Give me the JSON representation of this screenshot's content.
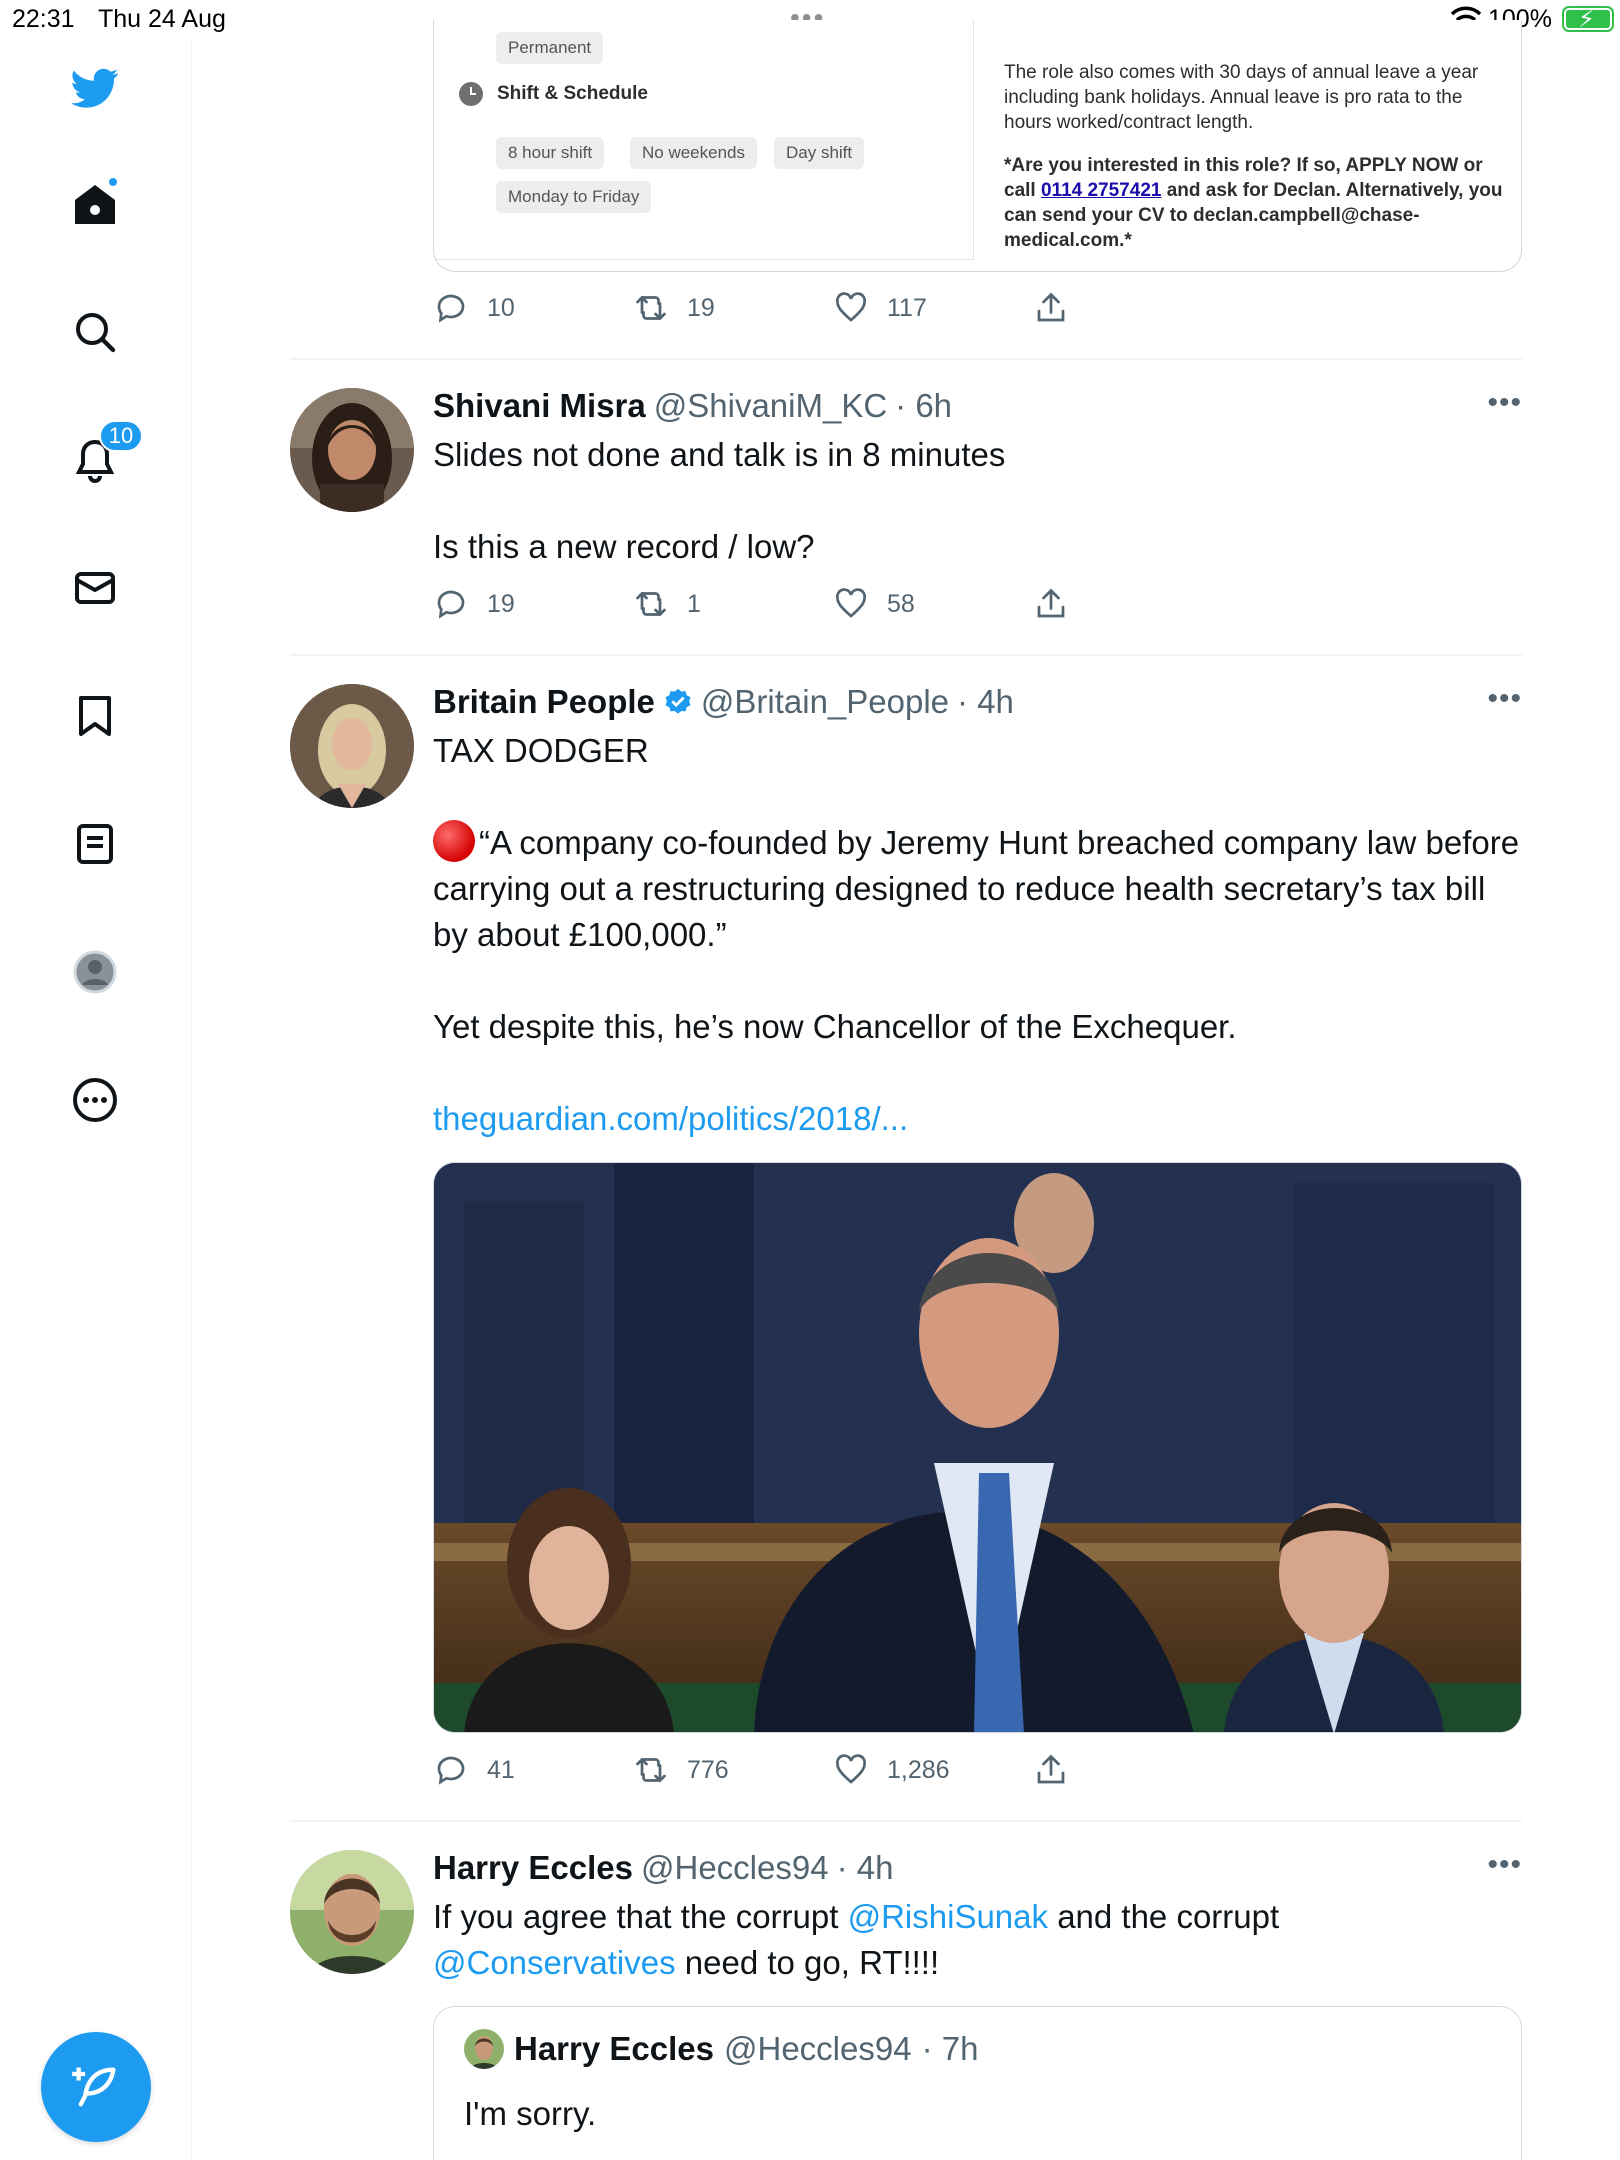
{
  "status_bar": {
    "time": "22:31",
    "date": "Thu 24 Aug",
    "battery": "100%"
  },
  "sidebar": {
    "notifications_badge": "10",
    "items": [
      {
        "icon": "twitter-bird-logo"
      },
      {
        "icon": "home-icon"
      },
      {
        "icon": "search-icon"
      },
      {
        "icon": "bell-icon"
      },
      {
        "icon": "mail-icon"
      },
      {
        "icon": "bookmark-icon"
      },
      {
        "icon": "lists-icon"
      },
      {
        "icon": "profile-icon"
      },
      {
        "icon": "more-icon"
      }
    ],
    "accent_color": "#1d9bf0"
  },
  "job_card": {
    "chip_permanent": "Permanent",
    "section_title": "Shift & Schedule",
    "chips": [
      "8 hour shift",
      "No weekends",
      "Day shift",
      "Monday to Friday"
    ],
    "text_leave": "The role also comes with 30 days of annual leave a year including bank holidays. Annual leave is pro rata to the hours worked/contract length.",
    "text_apply_1": "*Are you interested in this role? If so, APPLY NOW or call",
    "phone": "0114 2757421",
    "text_apply_2": "and ask for Declan. Alternatively, you can send your CV to declan.campbell@chase-medical.com.*"
  },
  "tweet0_actions": {
    "replies": "10",
    "retweets": "19",
    "likes": "117"
  },
  "tweets": [
    {
      "name": "Shivani Misra",
      "handle": "@ShivaniM_KC",
      "time": "· 6h",
      "text_1": "Slides not done and talk is in 8 minutes",
      "text_2": "Is this a new record / low?",
      "replies": "19",
      "retweets": "1",
      "likes": "58"
    },
    {
      "name": "Britain People",
      "handle": "@Britain_People",
      "time": "· 4h",
      "text_1": "TAX DODGER",
      "text_2": "“A company co-founded by Jeremy Hunt breached company law before carrying out a restructuring designed to reduce health secretary’s tax bill by about £100,000.”",
      "text_3": "Yet despite this, he’s now Chancellor of the Exchequer.",
      "link": "theguardian.com/politics/2018/...",
      "replies": "41",
      "retweets": "776",
      "likes": "1,286"
    },
    {
      "name": "Harry Eccles",
      "handle": "@Heccles94",
      "time": "· 4h",
      "text_a": "If you agree that the corrupt",
      "mention_1": "@RishiSunak",
      "text_b": "and the corrupt",
      "mention_2": "@Conservatives",
      "text_c": "need to go, RT!!!!",
      "quote": {
        "name": "Harry Eccles",
        "handle": "@Heccles94",
        "time": "· 7h",
        "text": "I'm sorry."
      }
    }
  ]
}
